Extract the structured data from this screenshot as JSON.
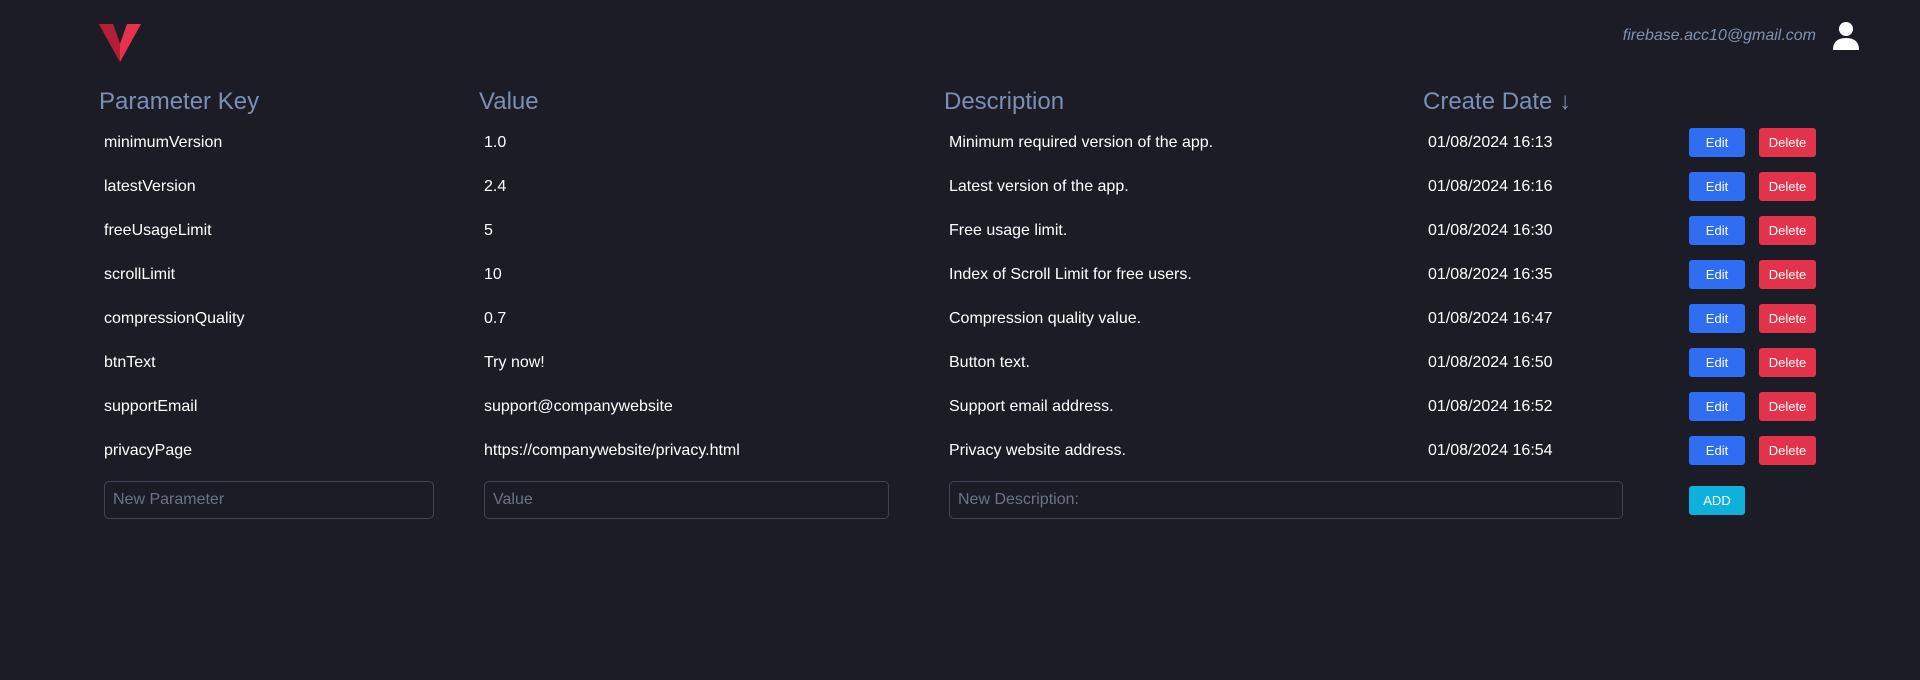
{
  "header": {
    "user_email": "firebase.acc10@gmail.com",
    "logo_icon": "v-logo",
    "user_icon": "user-icon",
    "colors": {
      "logo_red": "#e6334b",
      "logo_dark": "#b31f35"
    }
  },
  "table": {
    "headers": {
      "key": "Parameter Key",
      "value": "Value",
      "description": "Description",
      "create_date": "Create Date ↓"
    },
    "rows": [
      {
        "key": "minimumVersion",
        "value": "1.0",
        "description": "Minimum required version of the app.",
        "date": "01/08/2024 16:13"
      },
      {
        "key": "latestVersion",
        "value": "2.4",
        "description": "Latest version of the app.",
        "date": "01/08/2024 16:16"
      },
      {
        "key": "freeUsageLimit",
        "value": "5",
        "description": "Free usage limit.",
        "date": "01/08/2024 16:30"
      },
      {
        "key": "scrollLimit",
        "value": "10",
        "description": "Index of Scroll Limit for free users.",
        "date": "01/08/2024 16:35"
      },
      {
        "key": "compressionQuality",
        "value": "0.7",
        "description": "Compression quality value.",
        "date": "01/08/2024 16:47"
      },
      {
        "key": "btnText",
        "value": "Try now!",
        "description": "Button text.",
        "date": "01/08/2024 16:50"
      },
      {
        "key": "supportEmail",
        "value": "support@companywebsite",
        "description": "Support email address.",
        "date": "01/08/2024 16:52"
      },
      {
        "key": "privacyPage",
        "value": "https://companywebsite/privacy.html",
        "description": "Privacy website address.",
        "date": "01/08/2024 16:54"
      }
    ],
    "edit_label": "Edit",
    "delete_label": "Delete"
  },
  "add_form": {
    "key_placeholder": "New Parameter",
    "value_placeholder": "Value",
    "description_placeholder": "New Description:",
    "key_value": "",
    "value_value": "",
    "description_value": "",
    "add_label": "ADD"
  }
}
